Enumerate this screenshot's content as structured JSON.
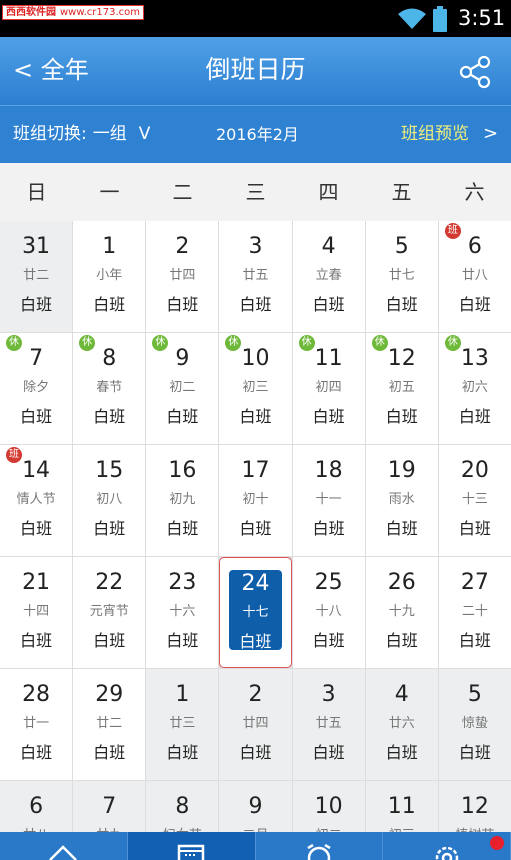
{
  "watermark": {
    "name": "西西软件园",
    "url": "www.cr173.com"
  },
  "status": {
    "time": "3:51"
  },
  "header": {
    "back_label": "< 全年",
    "title": "倒班日历"
  },
  "subbar": {
    "shift_label": "班组切换:",
    "shift_value": "一组",
    "shift_chevron": "V",
    "month": "2016年2月",
    "preview_label": "班组预览",
    "preview_chevron": ">"
  },
  "weekdays": [
    "日",
    "一",
    "二",
    "三",
    "四",
    "五",
    "六"
  ],
  "badge_text": {
    "rest": "休",
    "work": "班"
  },
  "colors": {
    "accent": "#2f82d2",
    "today": "#0e5eaa",
    "rest_badge": "#6fb93a",
    "work_badge": "#d23a32",
    "preview": "#f2ef7a"
  },
  "days": [
    {
      "d": "31",
      "l": "廿二",
      "s": "白班",
      "gray": true
    },
    {
      "d": "1",
      "l": "小年",
      "s": "白班"
    },
    {
      "d": "2",
      "l": "廿四",
      "s": "白班"
    },
    {
      "d": "3",
      "l": "廿五",
      "s": "白班"
    },
    {
      "d": "4",
      "l": "立春",
      "s": "白班"
    },
    {
      "d": "5",
      "l": "廿七",
      "s": "白班"
    },
    {
      "d": "6",
      "l": "廿八",
      "s": "白班",
      "badge": "work"
    },
    {
      "d": "7",
      "l": "除夕",
      "s": "白班",
      "badge": "rest"
    },
    {
      "d": "8",
      "l": "春节",
      "s": "白班",
      "badge": "rest"
    },
    {
      "d": "9",
      "l": "初二",
      "s": "白班",
      "badge": "rest"
    },
    {
      "d": "10",
      "l": "初三",
      "s": "白班",
      "badge": "rest"
    },
    {
      "d": "11",
      "l": "初四",
      "s": "白班",
      "badge": "rest"
    },
    {
      "d": "12",
      "l": "初五",
      "s": "白班",
      "badge": "rest"
    },
    {
      "d": "13",
      "l": "初六",
      "s": "白班",
      "badge": "rest"
    },
    {
      "d": "14",
      "l": "情人节",
      "s": "白班",
      "badge": "work"
    },
    {
      "d": "15",
      "l": "初八",
      "s": "白班"
    },
    {
      "d": "16",
      "l": "初九",
      "s": "白班"
    },
    {
      "d": "17",
      "l": "初十",
      "s": "白班"
    },
    {
      "d": "18",
      "l": "十一",
      "s": "白班"
    },
    {
      "d": "19",
      "l": "雨水",
      "s": "白班"
    },
    {
      "d": "20",
      "l": "十三",
      "s": "白班"
    },
    {
      "d": "21",
      "l": "十四",
      "s": "白班"
    },
    {
      "d": "22",
      "l": "元宵节",
      "s": "白班"
    },
    {
      "d": "23",
      "l": "十六",
      "s": "白班"
    },
    {
      "d": "24",
      "l": "十七",
      "s": "白班",
      "today": true
    },
    {
      "d": "25",
      "l": "十八",
      "s": "白班"
    },
    {
      "d": "26",
      "l": "十九",
      "s": "白班"
    },
    {
      "d": "27",
      "l": "二十",
      "s": "白班"
    },
    {
      "d": "28",
      "l": "廿一",
      "s": "白班"
    },
    {
      "d": "29",
      "l": "廿二",
      "s": "白班"
    },
    {
      "d": "1",
      "l": "廿三",
      "s": "白班",
      "gray": true
    },
    {
      "d": "2",
      "l": "廿四",
      "s": "白班",
      "gray": true
    },
    {
      "d": "3",
      "l": "廿五",
      "s": "白班",
      "gray": true
    },
    {
      "d": "4",
      "l": "廿六",
      "s": "白班",
      "gray": true
    },
    {
      "d": "5",
      "l": "惊蛰",
      "s": "白班",
      "gray": true
    },
    {
      "d": "6",
      "l": "廿八",
      "s": "",
      "gray": true
    },
    {
      "d": "7",
      "l": "廿九",
      "s": "",
      "gray": true
    },
    {
      "d": "8",
      "l": "妇女节",
      "s": "",
      "gray": true
    },
    {
      "d": "9",
      "l": "二月",
      "s": "",
      "gray": true
    },
    {
      "d": "10",
      "l": "初二",
      "s": "",
      "gray": true
    },
    {
      "d": "11",
      "l": "初三",
      "s": "",
      "gray": true
    },
    {
      "d": "12",
      "l": "植树节",
      "s": "",
      "gray": true
    }
  ],
  "tabs": [
    {
      "icon": "home-icon",
      "active": false
    },
    {
      "icon": "calendar-icon",
      "active": true
    },
    {
      "icon": "alarm-clock-icon",
      "active": false
    },
    {
      "icon": "settings-gear-icon",
      "active": false,
      "notification": true
    }
  ]
}
